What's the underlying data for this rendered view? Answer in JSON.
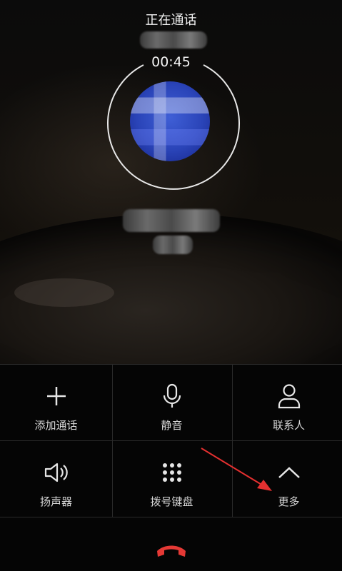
{
  "call": {
    "status": "正在通话",
    "duration": "00:45"
  },
  "actions": [
    {
      "label": "添加通话",
      "icon": "plus-icon"
    },
    {
      "label": "静音",
      "icon": "microphone-icon"
    },
    {
      "label": "联系人",
      "icon": "person-icon"
    },
    {
      "label": "扬声器",
      "icon": "speaker-icon"
    },
    {
      "label": "拨号键盘",
      "icon": "dialpad-icon"
    },
    {
      "label": "更多",
      "icon": "chevron-up-icon"
    }
  ],
  "colors": {
    "end_call": "#e53935",
    "annotation_arrow": "#e53030",
    "avatar_blue": "#2a44b8"
  }
}
